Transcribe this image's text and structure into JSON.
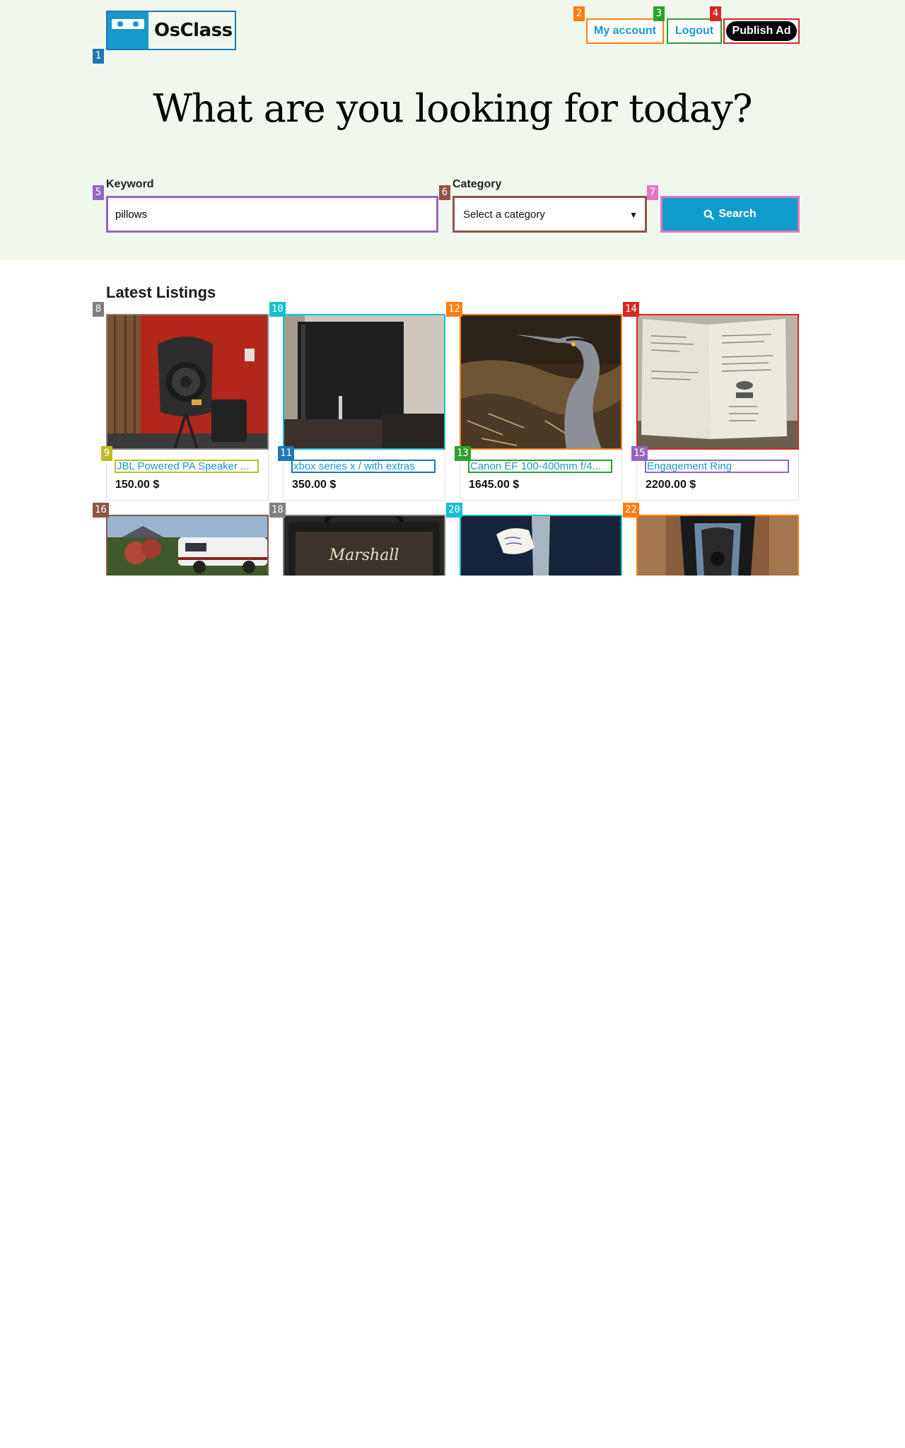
{
  "brand": {
    "name": "OsClass"
  },
  "header": {
    "my_account": "My account",
    "logout": "Logout",
    "publish_ad": "Publish Ad"
  },
  "hero": {
    "title": "What are you looking for today?"
  },
  "search": {
    "keyword_label": "Keyword",
    "keyword_value": "pillows",
    "category_label": "Category",
    "category_selected": "Select a category",
    "button_label": "Search"
  },
  "listings": {
    "title": "Latest Listings",
    "items": [
      {
        "title": "JBL Powered PA Speaker ...",
        "price": "150.00 $"
      },
      {
        "title": "xbox series x / with extras",
        "price": "350.00 $"
      },
      {
        "title": "Canon EF 100-400mm f/4...",
        "price": "1645.00 $"
      },
      {
        "title": "Engagement Ring",
        "price": "2200.00 $"
      }
    ]
  },
  "badges": [
    "1",
    "2",
    "3",
    "4",
    "5",
    "6",
    "7",
    "8",
    "9",
    "10",
    "11",
    "12",
    "13",
    "14",
    "15",
    "16",
    "18",
    "20",
    "22"
  ],
  "colors": {
    "hero_bg": "#f0f8ee",
    "accent": "#1899cc",
    "search_button": "#0f9ccb"
  }
}
